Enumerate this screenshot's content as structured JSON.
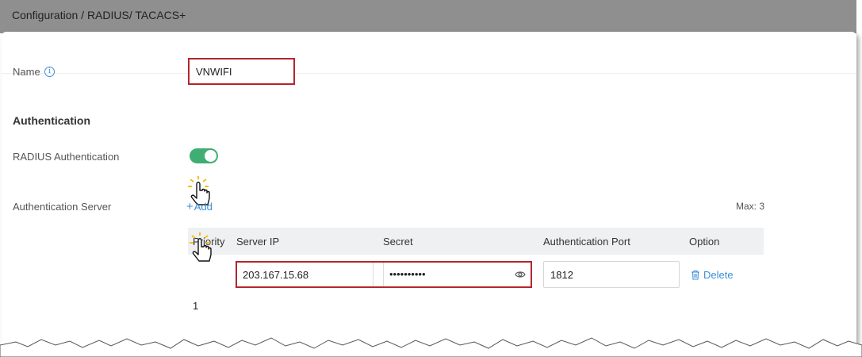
{
  "titlebar": {
    "breadcrumb": "Configuration / RADIUS/ TACACS+"
  },
  "form": {
    "name_label": "Name",
    "name_value": "VNWIFI",
    "section_authentication": "Authentication",
    "radius_auth_label": "RADIUS Authentication",
    "radius_auth_enabled": true,
    "auth_server_label": "Authentication Server",
    "add_label": "Add",
    "max_label": "Max: 3"
  },
  "table": {
    "columns": [
      "Priority",
      "Server IP",
      "Secret",
      "Authentication Port",
      "Option"
    ],
    "rows": [
      {
        "priority": "1",
        "server_ip": "203.167.15.68",
        "secret": "••••••••••",
        "port": "1812",
        "option": "Delete"
      }
    ]
  },
  "colors": {
    "accent": "#3b8fd8",
    "highlight": "#b3262b",
    "toggle_on": "#3fae73"
  },
  "icons": [
    "info-icon",
    "plus-icon",
    "eye-icon",
    "trash-icon",
    "hand-cursor-icon"
  ]
}
